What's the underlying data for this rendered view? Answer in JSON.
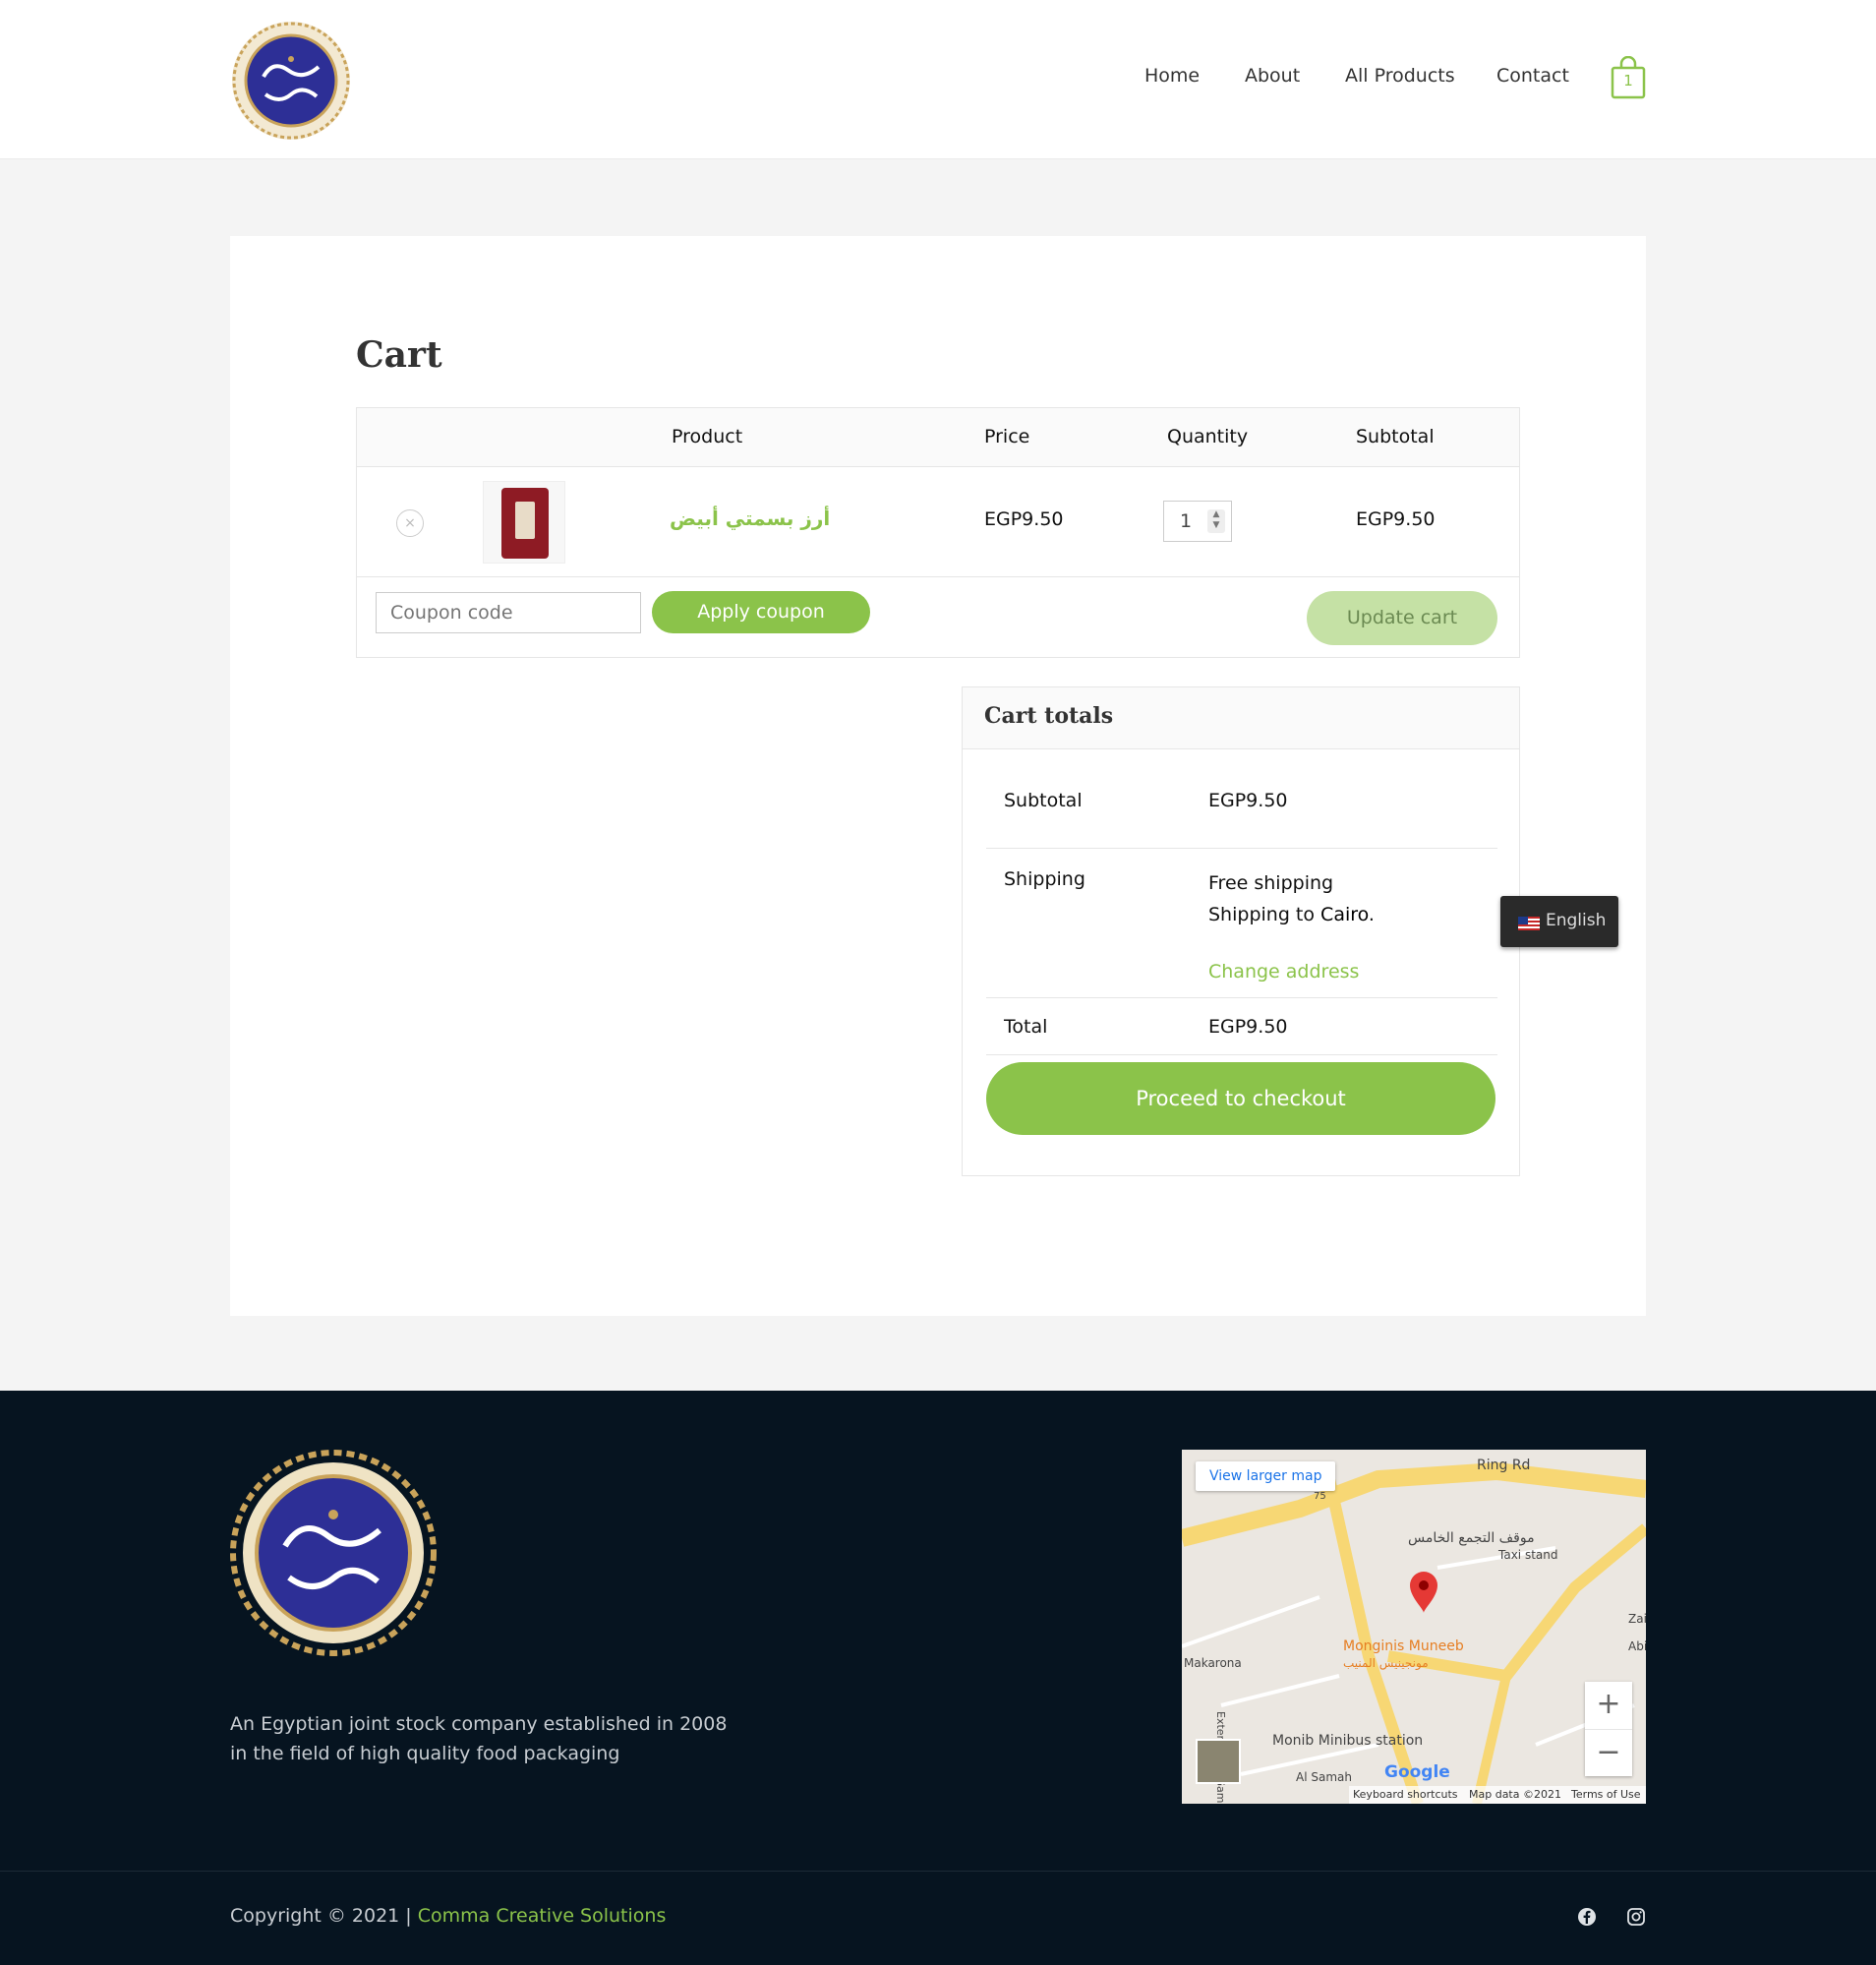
{
  "header": {
    "nav": [
      "Home",
      "About",
      "All Products",
      "Contact"
    ],
    "cart_count": "1"
  },
  "page": {
    "title": "Cart"
  },
  "cart_table": {
    "headers": [
      "Product",
      "Price",
      "Quantity",
      "Subtotal"
    ],
    "rows": [
      {
        "remove": "×",
        "product": "أرز بسمتي أبيض",
        "price": "EGP9.50",
        "quantity": "1",
        "subtotal": "EGP9.50"
      }
    ],
    "coupon_placeholder": "Coupon code",
    "apply_coupon": "Apply coupon",
    "update_cart": "Update cart"
  },
  "totals": {
    "title": "Cart totals",
    "subtotal_label": "Subtotal",
    "subtotal_value": "EGP9.50",
    "shipping_label": "Shipping",
    "shipping_method": "Free shipping",
    "shipping_to_prefix": "Shipping to",
    "shipping_city": "Cairo",
    "change_address": "Change address",
    "total_label": "Total",
    "total_value": "EGP9.50",
    "checkout": "Proceed to checkout"
  },
  "lang_switcher": {
    "label": "English"
  },
  "footer": {
    "about": "An Egyptian joint stock company established in 2008 in the field of high quality food packaging",
    "map": {
      "view_larger": "View larger map",
      "labels": [
        "Ring Rd",
        "موقف التجمع الخامس",
        "Taxi stand",
        "Monginis Muneeb",
        "مونجينيس المنيب",
        "Makarona",
        "Monib Minibus station",
        "Al Samah",
        "Extent of Al Game",
        "Zai",
        "Abi",
        "75"
      ],
      "google": "Google",
      "attrib": [
        "Keyboard shortcuts",
        "Map data ©2021",
        "Terms of Use"
      ]
    },
    "copyright": "Copyright © 2021 |",
    "copyright_link": "Comma Creative Solutions"
  },
  "colors": {
    "accent": "#8bc34a",
    "accent_light": "#c5e1a5",
    "footer_bg": "#061420",
    "logo_blue": "#2d2f96",
    "logo_gold": "#c9a35a"
  },
  "icons": [
    "logo-emblem",
    "shopping-bag-icon",
    "remove-icon",
    "flag-us-icon",
    "map-pin-icon",
    "facebook-icon",
    "instagram-icon"
  ]
}
